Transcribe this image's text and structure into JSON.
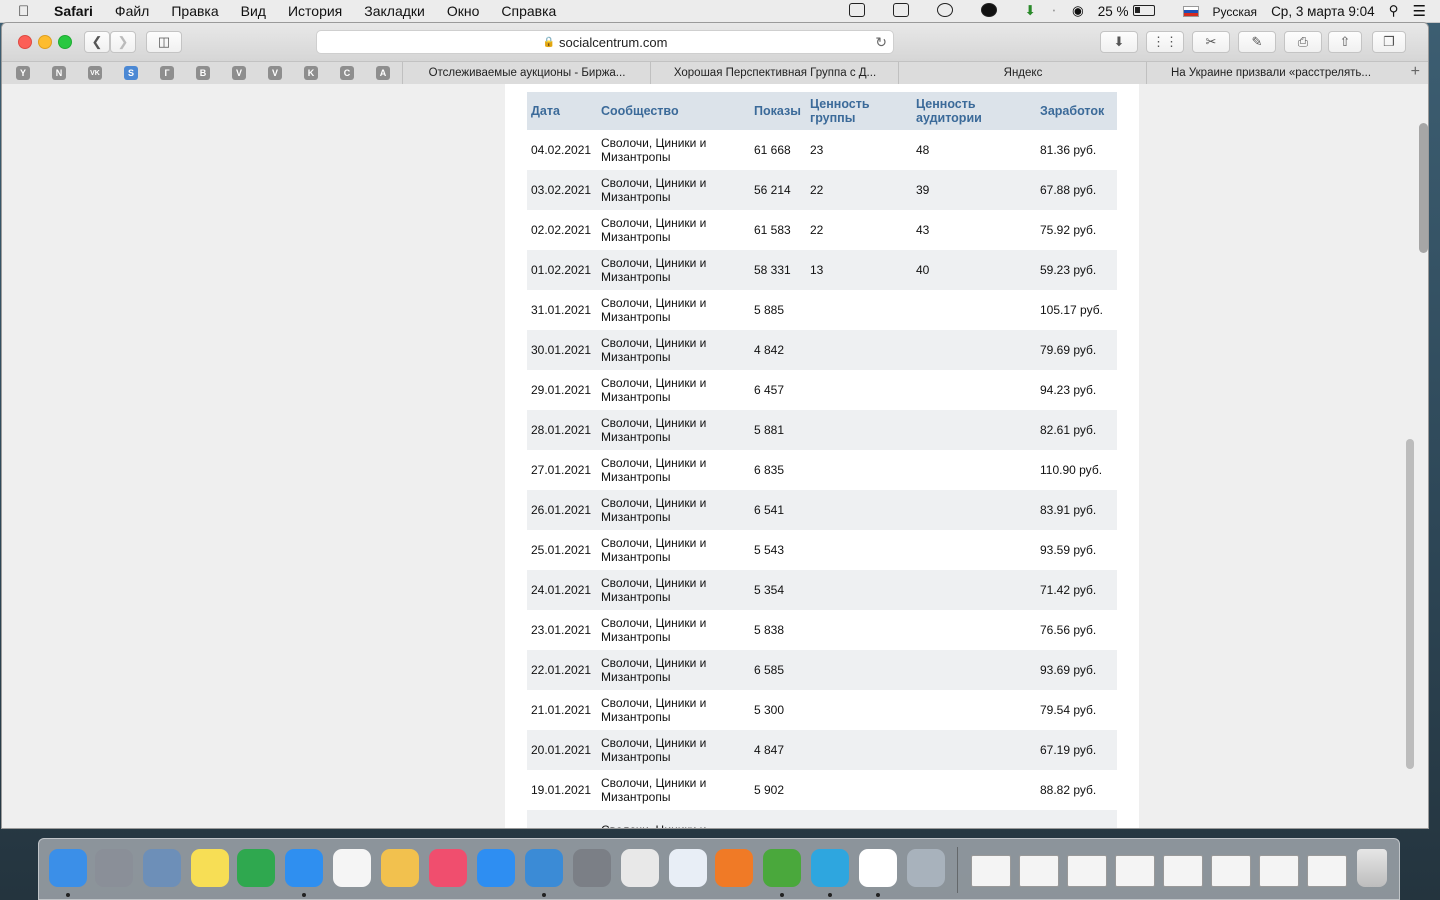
{
  "menubar": {
    "app": "Safari",
    "items": [
      "Файл",
      "Правка",
      "Вид",
      "История",
      "Закладки",
      "Окно",
      "Справка"
    ],
    "battery": "25 %",
    "input_source": "Русская",
    "clock": "Ср, 3 марта  9:04"
  },
  "toolbar": {
    "url": "socialcentrum.com"
  },
  "favorites": {
    "icons": [
      "Y",
      "N",
      "VK",
      "S",
      "Г",
      "B",
      "V",
      "V",
      "K",
      "C",
      "A"
    ],
    "tabs": [
      "Отслеживаемые аукционы - Биржа...",
      "Хорошая Перспективная Группа с Д...",
      "Яндекс",
      "На Украине призвали «расстрелять..."
    ]
  },
  "table": {
    "headers": {
      "date": "Дата",
      "community": "Сообщество",
      "views": "Показы",
      "group_value": "Ценность группы",
      "audience_value": "Ценность аудитории",
      "earnings": "Заработок"
    },
    "rows": [
      {
        "date": "04.02.2021",
        "community": "Сволочи, Циники и Мизантропы",
        "views": "61 668",
        "group_value": "23",
        "audience_value": "48",
        "earnings": "81.36 руб."
      },
      {
        "date": "03.02.2021",
        "community": "Сволочи, Циники и Мизантропы",
        "views": "56 214",
        "group_value": "22",
        "audience_value": "39",
        "earnings": "67.88 руб."
      },
      {
        "date": "02.02.2021",
        "community": "Сволочи, Циники и Мизантропы",
        "views": "61 583",
        "group_value": "22",
        "audience_value": "43",
        "earnings": "75.92 руб."
      },
      {
        "date": "01.02.2021",
        "community": "Сволочи, Циники и Мизантропы",
        "views": "58 331",
        "group_value": "13",
        "audience_value": "40",
        "earnings": "59.23 руб."
      },
      {
        "date": "31.01.2021",
        "community": "Сволочи, Циники и Мизантропы",
        "views": "5 885",
        "group_value": "",
        "audience_value": "",
        "earnings": "105.17 руб."
      },
      {
        "date": "30.01.2021",
        "community": "Сволочи, Циники и Мизантропы",
        "views": "4 842",
        "group_value": "",
        "audience_value": "",
        "earnings": "79.69 руб."
      },
      {
        "date": "29.01.2021",
        "community": "Сволочи, Циники и Мизантропы",
        "views": "6 457",
        "group_value": "",
        "audience_value": "",
        "earnings": "94.23 руб."
      },
      {
        "date": "28.01.2021",
        "community": "Сволочи, Циники и Мизантропы",
        "views": "5 881",
        "group_value": "",
        "audience_value": "",
        "earnings": "82.61 руб."
      },
      {
        "date": "27.01.2021",
        "community": "Сволочи, Циники и Мизантропы",
        "views": "6 835",
        "group_value": "",
        "audience_value": "",
        "earnings": "110.90 руб."
      },
      {
        "date": "26.01.2021",
        "community": "Сволочи, Циники и Мизантропы",
        "views": "6 541",
        "group_value": "",
        "audience_value": "",
        "earnings": "83.91 руб."
      },
      {
        "date": "25.01.2021",
        "community": "Сволочи, Циники и Мизантропы",
        "views": "5 543",
        "group_value": "",
        "audience_value": "",
        "earnings": "93.59 руб."
      },
      {
        "date": "24.01.2021",
        "community": "Сволочи, Циники и Мизантропы",
        "views": "5 354",
        "group_value": "",
        "audience_value": "",
        "earnings": "71.42 руб."
      },
      {
        "date": "23.01.2021",
        "community": "Сволочи, Циники и Мизантропы",
        "views": "5 838",
        "group_value": "",
        "audience_value": "",
        "earnings": "76.56 руб."
      },
      {
        "date": "22.01.2021",
        "community": "Сволочи, Циники и Мизантропы",
        "views": "6 585",
        "group_value": "",
        "audience_value": "",
        "earnings": "93.69 руб."
      },
      {
        "date": "21.01.2021",
        "community": "Сволочи, Циники и Мизантропы",
        "views": "5 300",
        "group_value": "",
        "audience_value": "",
        "earnings": "79.54 руб."
      },
      {
        "date": "20.01.2021",
        "community": "Сволочи, Циники и Мизантропы",
        "views": "4 847",
        "group_value": "",
        "audience_value": "",
        "earnings": "67.19 руб."
      },
      {
        "date": "19.01.2021",
        "community": "Сволочи, Циники и Мизантропы",
        "views": "5 902",
        "group_value": "",
        "audience_value": "",
        "earnings": "88.82 руб."
      },
      {
        "date": "",
        "community": "Сволочи, Циники и",
        "views": "",
        "group_value": "",
        "audience_value": "",
        "earnings": ""
      }
    ]
  },
  "dock": {
    "apps": [
      {
        "name": "finder",
        "color": "#3b8fe8"
      },
      {
        "name": "launchpad",
        "color": "#8a8f98"
      },
      {
        "name": "mail-eagle",
        "color": "#6d8fb8"
      },
      {
        "name": "notes",
        "color": "#f7de55"
      },
      {
        "name": "numbers",
        "color": "#2fa84f"
      },
      {
        "name": "safari",
        "color": "#2f8ff0"
      },
      {
        "name": "calendar",
        "color": "#f5f5f5"
      },
      {
        "name": "photos",
        "color": "#f2c14e"
      },
      {
        "name": "music",
        "color": "#f04e6e"
      },
      {
        "name": "app-store",
        "color": "#2e8ef2"
      },
      {
        "name": "preview",
        "color": "#3b8bd6"
      },
      {
        "name": "system-preferences",
        "color": "#7b7f86"
      },
      {
        "name": "textedit",
        "color": "#e8e8e8"
      },
      {
        "name": "activity-app",
        "color": "#e8eef6"
      },
      {
        "name": "firefox",
        "color": "#f07a26"
      },
      {
        "name": "green-app",
        "color": "#4aa83c"
      },
      {
        "name": "telegram",
        "color": "#2ea6df"
      },
      {
        "name": "j-app",
        "color": "#ffffff"
      },
      {
        "name": "image-capture",
        "color": "#a8b2bc"
      }
    ],
    "minimized": [
      "window-1",
      "window-2",
      "window-3",
      "window-4",
      "window-5",
      "window-6",
      "window-7",
      "window-8"
    ],
    "trash": "trash"
  }
}
